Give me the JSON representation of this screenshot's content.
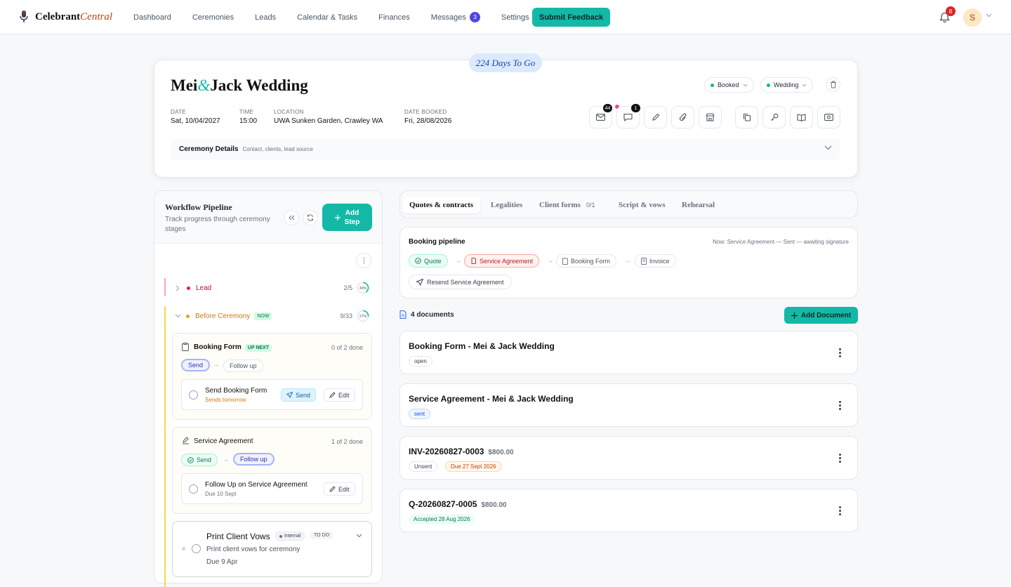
{
  "app": {
    "name_main": "Celebrant",
    "name_accent": "Central"
  },
  "nav": {
    "items": [
      "Dashboard",
      "Ceremonies",
      "Leads",
      "Calendar & Tasks",
      "Finances",
      "Messages",
      "Settings"
    ],
    "messages_badge": "3",
    "feedback_label": "Submit Feedback"
  },
  "user": {
    "notifications": "8",
    "avatar_initial": "S"
  },
  "ceremony": {
    "countdown": "224 Days To Go",
    "title_a": "Mei",
    "amp": "&",
    "title_b": "Jack Wedding",
    "status": "Booked",
    "type": "Wedding",
    "meta": [
      {
        "label": "DATE",
        "value": "Sat, 10/04/2027"
      },
      {
        "label": "TIME",
        "value": "15:00"
      },
      {
        "label": "LOCATION",
        "value": "UWA Sunken Garden, Crawley WA"
      },
      {
        "label": "DATE BOOKED",
        "value": "Fri, 28/08/2026"
      }
    ],
    "email_badge": "44",
    "chat_badge": "1",
    "details_title": "Ceremony Details",
    "details_sub": "Contact, clients, lead source"
  },
  "workflow": {
    "title": "Workflow Pipeline",
    "subtitle": "Track progress through ceremony stages",
    "add_label_1": "Add",
    "add_label_2": "Step",
    "stages": [
      {
        "name": "Lead",
        "count": "2/5",
        "pct": "40%",
        "fraction": 0.4,
        "color": "#e11d48"
      },
      {
        "name": "Before Ceremony",
        "count": "9/33",
        "pct": "27%",
        "fraction": 0.27,
        "color": "#d97706",
        "tag": "NOW"
      }
    ],
    "booking_form": {
      "title": "Booking Form",
      "tag": "UP NEXT",
      "done": "0 of 2 done",
      "chip_send": "Send",
      "chip_follow": "Follow up",
      "task_title": "Send Booking Form",
      "task_sub": "Sends tomorrow",
      "send_btn": "Send",
      "edit_btn": "Edit"
    },
    "service_agreement": {
      "title": "Service Agreement",
      "done": "1 of 2 done",
      "chip_send": "Send",
      "chip_follow": "Follow up",
      "task_title": "Follow Up on Service Agreement",
      "task_sub": "Due 10 Sept",
      "edit_btn": "Edit"
    },
    "print_vows": {
      "title": "Print Client Vows",
      "tag_internal": "Internal",
      "tag_todo": "TO DO",
      "desc": "Print client vows for ceremony",
      "due": "Due 9 Apr"
    }
  },
  "tabs": [
    {
      "label": "Quotes & contracts"
    },
    {
      "label": "Legalities"
    },
    {
      "label": "Client forms",
      "count": "0/1"
    },
    {
      "label": "Script & vows"
    },
    {
      "label": "Rehearsal"
    }
  ],
  "booking_pipeline": {
    "title": "Booking pipeline",
    "now": "Now: Service Agreement — Sent — awaiting signature",
    "steps": [
      "Quote",
      "Service Agreement",
      "Booking Form",
      "Invoice"
    ],
    "resend": "Resend Service Agreement"
  },
  "documents": {
    "count_label": "4 documents",
    "add_label": "Add Document",
    "items": [
      {
        "title": "Booking Form - Mei & Jack Wedding",
        "amount": "",
        "tags": [
          "open"
        ]
      },
      {
        "title": "Service Agreement - Mei & Jack Wedding",
        "amount": "",
        "tags": [
          "sent"
        ]
      },
      {
        "title": "INV-20260827-0003",
        "amount": "$800.00",
        "tags": [
          "Unsent",
          "Due 27 Sept 2026"
        ]
      },
      {
        "title": "Q-20260827-0005",
        "amount": "$800.00",
        "tags": [
          "Accepted 28 Aug 2026"
        ]
      }
    ]
  }
}
